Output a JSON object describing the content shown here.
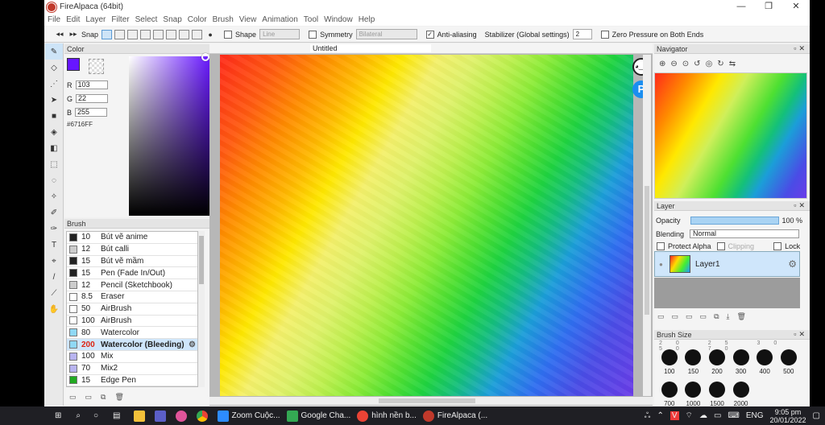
{
  "window": {
    "title": "FireAlpaca (64bit)",
    "minimize": "—",
    "restore": "❐",
    "close": "✕"
  },
  "menu": [
    "File",
    "Edit",
    "Layer",
    "Filter",
    "Select",
    "Snap",
    "Color",
    "Brush",
    "View",
    "Animation",
    "Tool",
    "Window",
    "Help"
  ],
  "toolbar": {
    "snap_label": "Snap",
    "shape_label": "Shape",
    "shape_value": "Line",
    "symmetry_label": "Symmetry",
    "symmetry_value": "Bilateral",
    "antialias_label": "Anti-aliasing",
    "antialias_checked": "✓",
    "stabilizer_label": "Stabilizer (Global settings)",
    "stabilizer_value": "2",
    "zero_pressure_label": "Zero Pressure on Both Ends"
  },
  "color_panel": {
    "title": "Color",
    "r_label": "R",
    "r_value": "103",
    "g_label": "G",
    "g_value": "22",
    "b_label": "B",
    "b_value": "255",
    "hex": "#6716FF",
    "current_color": "#6716ff"
  },
  "brush_panel": {
    "title": "Brush",
    "items": [
      {
        "size": "10",
        "name": "Bút vẽ anime",
        "color": "#222222"
      },
      {
        "size": "12",
        "name": "Bút calli",
        "color": "#cccccc"
      },
      {
        "size": "15",
        "name": "Bút vẽ mầm",
        "color": "#222222"
      },
      {
        "size": "15",
        "name": "Pen (Fade In/Out)",
        "color": "#222222"
      },
      {
        "size": "12",
        "name": "Pencil (Sketchbook)",
        "color": "#cccccc"
      },
      {
        "size": "8.5",
        "name": "Eraser",
        "color": "#ffffff"
      },
      {
        "size": "50",
        "name": "AirBrush",
        "color": "#ffffff"
      },
      {
        "size": "100",
        "name": "AirBrush",
        "color": "#ffffff"
      },
      {
        "size": "80",
        "name": "Watercolor",
        "color": "#8fd8f5"
      },
      {
        "size": "200",
        "name": "Watercolor (Bleeding)",
        "color": "#8fd8f5",
        "selected": true
      },
      {
        "size": "100",
        "name": "Mix",
        "color": "#b8b4f0"
      },
      {
        "size": "70",
        "name": "Mix2",
        "color": "#b8b4f0"
      },
      {
        "size": "15",
        "name": "Edge Pen",
        "color": "#22aa22"
      }
    ]
  },
  "document": {
    "tab": "Untitled"
  },
  "navigator": {
    "title": "Navigator"
  },
  "layer_panel": {
    "title": "Layer",
    "opacity_label": "Opacity",
    "opacity_value": "100 %",
    "opacity": 1.0,
    "blending_label": "Blending",
    "blending_value": "Normal",
    "protect_alpha": "Protect Alpha",
    "clipping": "Clipping",
    "lock": "Lock",
    "layers": [
      {
        "name": "Layer1"
      }
    ]
  },
  "brush_size_panel": {
    "title": "Brush Size",
    "top_row": "20  25  30  50  70",
    "sizes": [
      "100",
      "150",
      "200",
      "300",
      "400",
      "500",
      "700",
      "1000",
      "1500",
      "2000"
    ]
  },
  "taskbar": {
    "apps": [
      {
        "label": "Zoom Cuộc...",
        "color": "#2d8cff"
      },
      {
        "label": "Google Cha...",
        "color": "#34a853"
      },
      {
        "label": "hình nền b...",
        "color": "#ea4335"
      },
      {
        "label": "FireAlpaca (...",
        "color": "#c0392b"
      }
    ],
    "lang": "ENG",
    "time": "9:05 pm",
    "date": "20/01/2022"
  }
}
